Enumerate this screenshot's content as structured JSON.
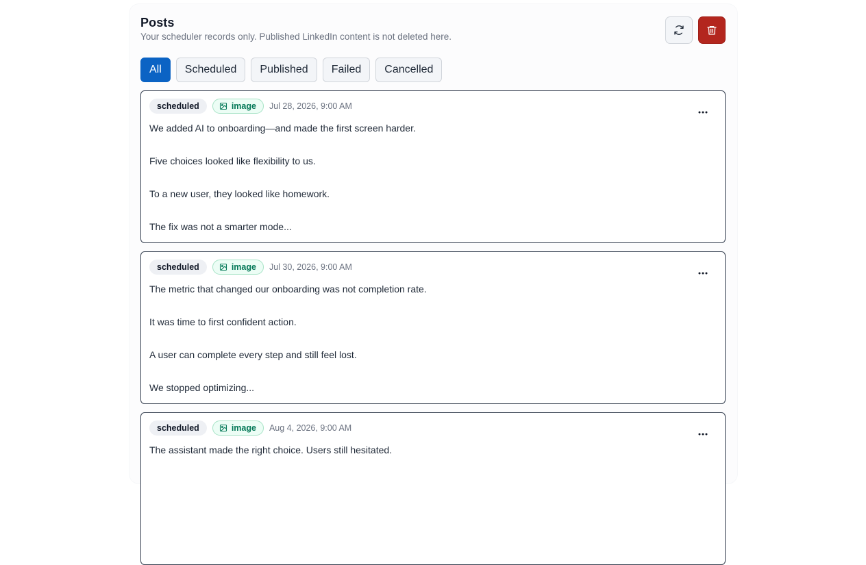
{
  "header": {
    "title": "Posts",
    "subtitle": "Your scheduler records only. Published LinkedIn content is not deleted here.",
    "refresh_icon": "refresh-icon",
    "delete_icon": "trash-icon"
  },
  "tabs": [
    {
      "label": "All",
      "active": true
    },
    {
      "label": "Scheduled",
      "active": false
    },
    {
      "label": "Published",
      "active": false
    },
    {
      "label": "Failed",
      "active": false
    },
    {
      "label": "Cancelled",
      "active": false
    }
  ],
  "posts": [
    {
      "status": "scheduled",
      "media": "image",
      "date": "Jul 28, 2026, 9:00 AM",
      "lines": [
        "We added AI to onboarding—and made the first screen harder.",
        "Five choices looked like flexibility to us.",
        "To a new user, they looked like homework.",
        "The fix was not a smarter mode..."
      ]
    },
    {
      "status": "scheduled",
      "media": "image",
      "date": "Jul 30, 2026, 9:00 AM",
      "lines": [
        "The metric that changed our onboarding was not completion rate.",
        "It was time to first confident action.",
        "A user can complete every step and still feel lost.",
        "We stopped optimizing..."
      ]
    },
    {
      "status": "scheduled",
      "media": "image",
      "date": "Aug 4, 2026, 9:00 AM",
      "lines": [
        "The assistant made the right choice. Users still hesitated."
      ]
    }
  ],
  "colors": {
    "accent": "#0b63c4",
    "danger": "#b3261e",
    "media_badge_text": "#047857"
  }
}
